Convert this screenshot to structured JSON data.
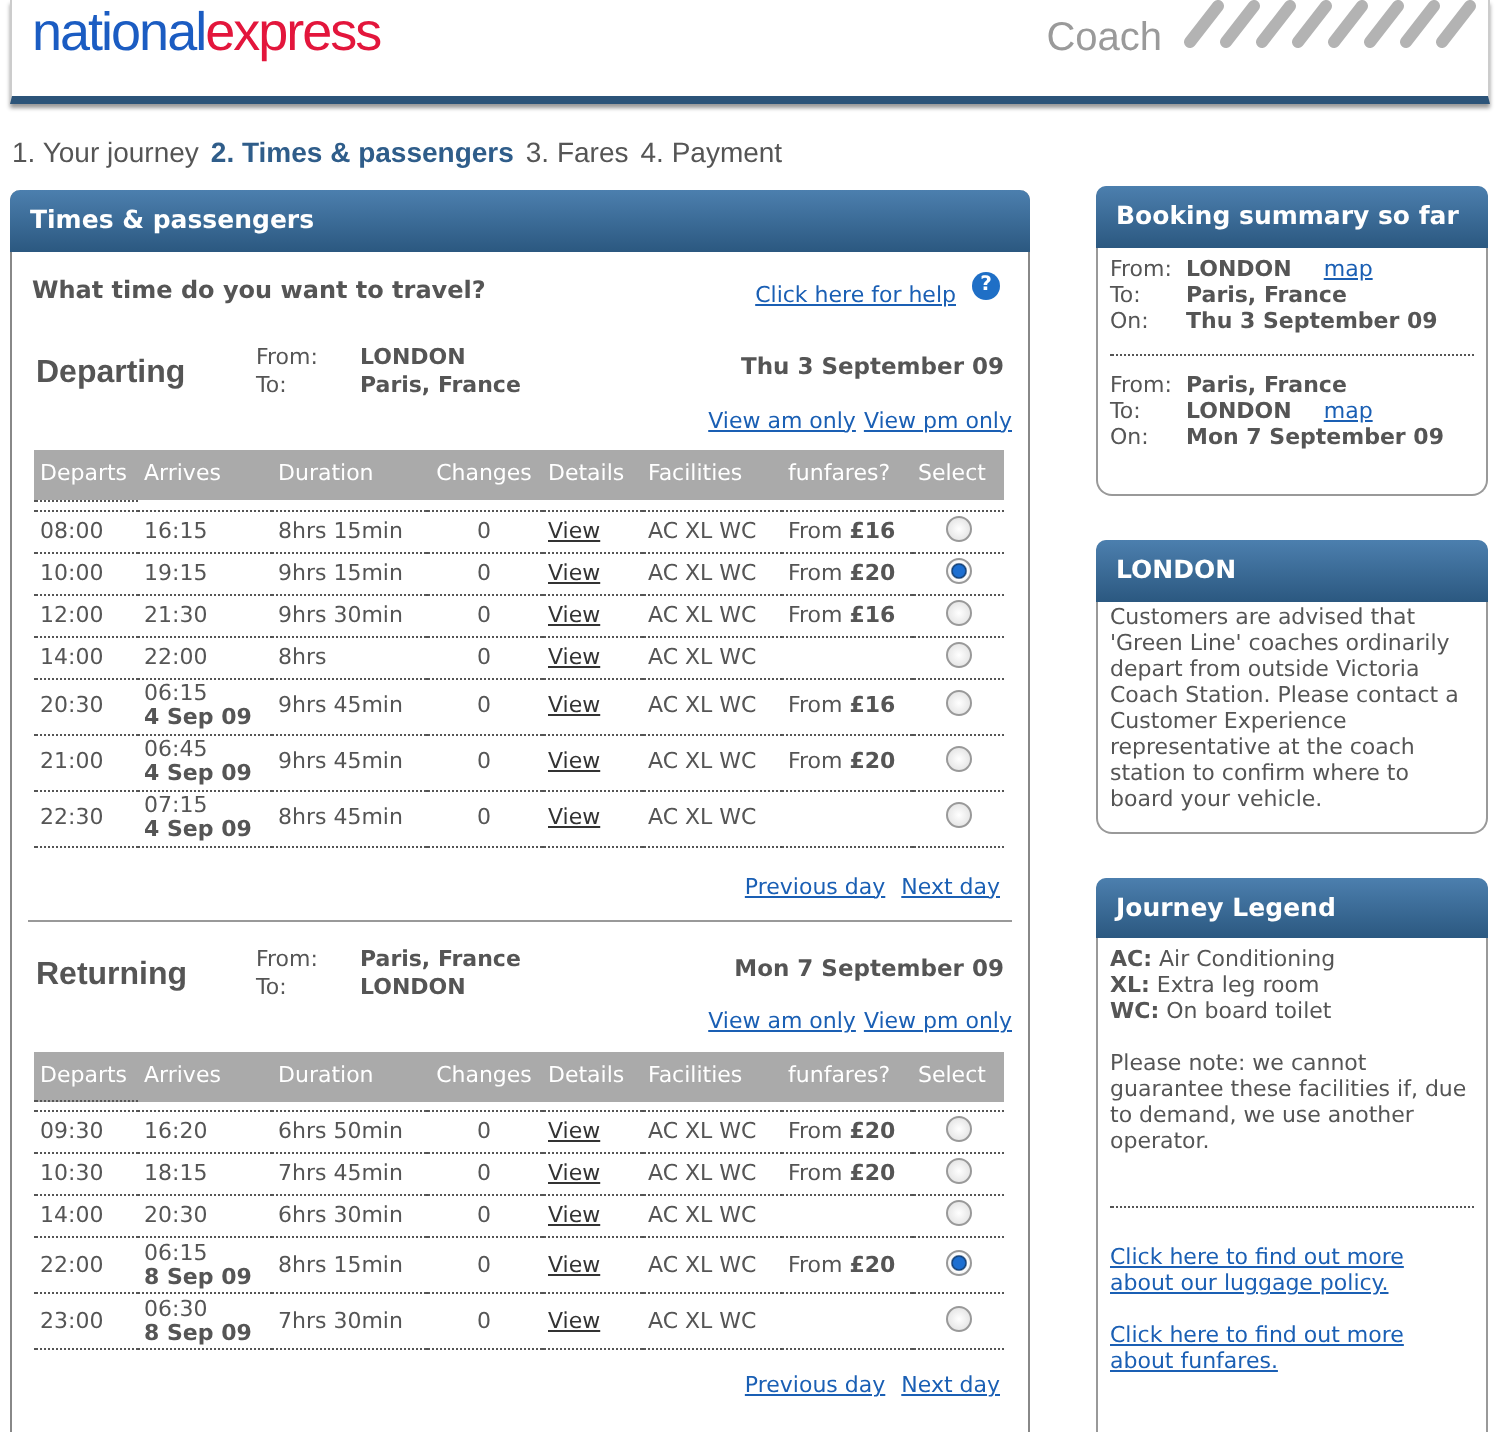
{
  "header": {
    "logo_first": "national",
    "logo_second": "express",
    "tagline": "Coach"
  },
  "steps": [
    {
      "label": "1. Your journey",
      "selected": false
    },
    {
      "label": "2. Times & passengers",
      "selected": true
    },
    {
      "label": "3. Fares",
      "selected": false
    },
    {
      "label": "4. Payment",
      "selected": false
    }
  ],
  "main": {
    "title": "Times & passengers",
    "question": "What time do you want to travel?",
    "help_link": "Click here for help",
    "help_icon": "?",
    "journeys": [
      {
        "heading": "Departing",
        "from_label": "From:",
        "from": "LONDON",
        "to_label": "To:",
        "to": "Paris, France",
        "date": "Thu 3 September 09",
        "am_link": "View am only",
        "pm_link": "View pm only",
        "columns": [
          "Departs",
          "Arrives",
          "Duration",
          "Changes",
          "Details",
          "Facilities",
          "funfares?",
          "Select"
        ],
        "rows": [
          {
            "departs": "08:00",
            "arrives": "16:15",
            "duration": "8hrs 15min",
            "changes": "0",
            "details": "View",
            "facilities": "AC XL WC",
            "fare": "From **£16**",
            "selected": false
          },
          {
            "departs": "10:00",
            "arrives": "19:15",
            "duration": "9hrs 15min",
            "changes": "0",
            "details": "View",
            "facilities": "AC XL WC",
            "fare": "From **£20**",
            "selected": true
          },
          {
            "departs": "12:00",
            "arrives": "21:30",
            "duration": "9hrs 30min",
            "changes": "0",
            "details": "View",
            "facilities": "AC XL WC",
            "fare": "From **£16**",
            "selected": false
          },
          {
            "departs": "14:00",
            "arrives": "22:00",
            "duration": "8hrs",
            "changes": "0",
            "details": "View",
            "facilities": "AC XL WC",
            "selected": false
          },
          {
            "departs": "20:30",
            "arrives": "06:15",
            "arrives_date": "4 Sep 09",
            "duration": "9hrs 45min",
            "changes": "0",
            "details": "View",
            "facilities": "AC XL WC",
            "fare": "From **£16**",
            "selected": false
          },
          {
            "departs": "21:00",
            "arrives": "06:45",
            "arrives_date": "4 Sep 09",
            "duration": "9hrs 45min",
            "changes": "0",
            "details": "View",
            "facilities": "AC XL WC",
            "fare": "From **£20**",
            "selected": false
          },
          {
            "departs": "22:30",
            "arrives": "07:15",
            "arrives_date": "4 Sep 09",
            "duration": "8hrs 45min",
            "changes": "0",
            "details": "View",
            "facilities": "AC XL WC",
            "selected": false
          }
        ],
        "prev_link": "Previous day",
        "next_link": "Next day"
      },
      {
        "heading": "Returning",
        "from_label": "From:",
        "from": "Paris, France",
        "to_label": "To:",
        "to": "LONDON",
        "date": "Mon 7 September 09",
        "am_link": "View am only",
        "pm_link": "View pm only",
        "columns": [
          "Departs",
          "Arrives",
          "Duration",
          "Changes",
          "Details",
          "Facilities",
          "funfares?",
          "Select"
        ],
        "rows": [
          {
            "departs": "09:30",
            "arrives": "16:20",
            "duration": "6hrs 50min",
            "changes": "0",
            "details": "View",
            "facilities": "AC XL WC",
            "fare": "From **£20**",
            "selected": false
          },
          {
            "departs": "10:30",
            "arrives": "18:15",
            "duration": "7hrs 45min",
            "changes": "0",
            "details": "View",
            "facilities": "AC XL WC",
            "fare": "From **£20**",
            "selected": false
          },
          {
            "departs": "14:00",
            "arrives": "20:30",
            "duration": "6hrs 30min",
            "changes": "0",
            "details": "View",
            "facilities": "AC XL WC",
            "selected": false
          },
          {
            "departs": "22:00",
            "arrives": "06:15",
            "arrives_date": "8 Sep 09",
            "duration": "8hrs 15min",
            "changes": "0",
            "details": "View",
            "facilities": "AC XL WC",
            "fare": "From **£20**",
            "selected": true
          },
          {
            "departs": "23:00",
            "arrives": "06:30",
            "arrives_date": "8 Sep 09",
            "duration": "7hrs 30min",
            "changes": "0",
            "details": "View",
            "facilities": "AC XL WC",
            "selected": false
          }
        ],
        "prev_link": "Previous day",
        "next_link": "Next day"
      }
    ]
  },
  "sidebar": {
    "summary": {
      "title": "Booking summary so far",
      "legs": [
        {
          "lines": [
            {
              "label": "From:",
              "value": "LONDON",
              "link": "map"
            },
            {
              "label": "To:",
              "value": "Paris, France"
            },
            {
              "label": "On:",
              "value": "Thu 3 September 09"
            }
          ]
        },
        {
          "lines": [
            {
              "label": "From:",
              "value": "Paris, France"
            },
            {
              "label": "To:",
              "value": "LONDON",
              "link": "map"
            },
            {
              "label": "On:",
              "value": "Mon 7 September 09"
            }
          ]
        }
      ]
    },
    "notice": {
      "title": "LONDON",
      "text": "Customers are advised that 'Green Line' coaches ordinarily depart from outside Victoria Coach Station. Please contact a Customer Experience representative at the coach station to confirm where to board your vehicle."
    },
    "legend": {
      "title": "Journey Legend",
      "items": [
        "**AC:** Air Conditioning",
        "**XL:** Extra leg room",
        "**WC:** On board toilet"
      ],
      "note": "Please note: we cannot guarantee these facilities if, due to demand, we use another operator.",
      "links": [
        "Click here to find out more about our luggage policy.",
        "Click here to find out more about funfares."
      ]
    }
  }
}
